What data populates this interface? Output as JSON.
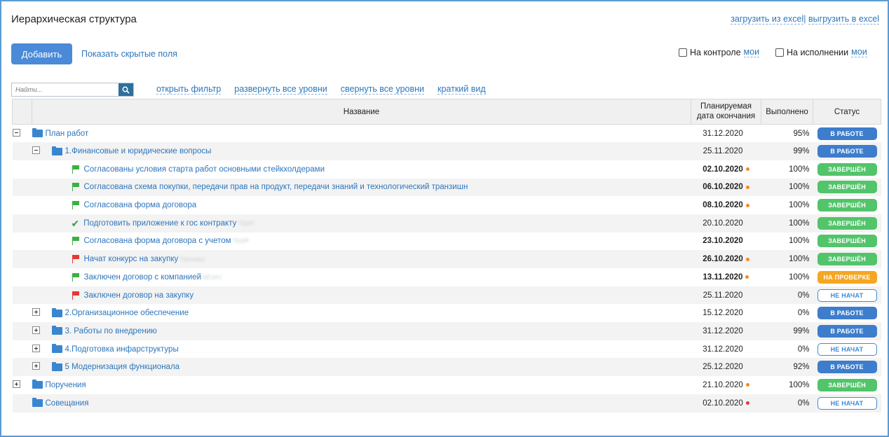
{
  "header": {
    "title": "Иерархическая структура",
    "upload_excel": "загрузить из excel",
    "separator": "|",
    "download_excel": "выгрузить в excel"
  },
  "toolbar": {
    "add_label": "Добавить",
    "show_hidden_label": "Показать скрытые поля",
    "control_label": "На контроле",
    "control_mine": "мои",
    "exec_label": "На исполнении",
    "exec_mine": "мои"
  },
  "search": {
    "placeholder": "Найти..."
  },
  "tools": {
    "open_filter": "открыть фильтр",
    "expand_all": "развернуть все уровни",
    "collapse_all": "свернуть все уровни",
    "brief_view": "краткий вид"
  },
  "table": {
    "col_name": "Название",
    "col_date_1": "Планируемая",
    "col_date_2": "дата окончания",
    "col_done": "Выполнено",
    "col_status": "Статус"
  },
  "colors": {
    "accent": "#4a8ad8",
    "link": "#2d76bb",
    "status_work": "#3d7dcc",
    "status_done": "#52c46a",
    "status_review": "#f5a623",
    "flag_green": "#3cb043",
    "flag_red": "#e53935",
    "dot_orange": "#f5891f",
    "dot_red": "#e53935"
  },
  "rows": [
    {
      "level": 0,
      "toggle": "minus",
      "icon": "folder-icon",
      "name": "План работ",
      "blur": "",
      "date": "31.12.2020",
      "bold": false,
      "dot": "",
      "pct": "95%",
      "status": "В РАБОТЕ",
      "kind": "work",
      "alt": false
    },
    {
      "level": 1,
      "toggle": "minus",
      "icon": "folder-icon",
      "name": "1.Финансовые и юридические вопросы",
      "blur": "",
      "date": "25.11.2020",
      "bold": false,
      "dot": "",
      "pct": "99%",
      "status": "В РАБОТЕ",
      "kind": "work",
      "alt": true
    },
    {
      "level": 2,
      "toggle": "",
      "icon": "green-flag-icon",
      "name": "Согласованы условия старта работ основными стейкхолдерами",
      "blur": "",
      "date": "02.10.2020",
      "bold": true,
      "dot": "orange",
      "pct": "100%",
      "status": "ЗАВЕРШЁН",
      "kind": "done",
      "alt": false
    },
    {
      "level": 2,
      "toggle": "",
      "icon": "green-flag-icon",
      "name": "Согласована схема покупки, передачи прав на продукт, передачи знаний и технологический транзишн",
      "blur": "",
      "date": "06.10.2020",
      "bold": true,
      "dot": "orange",
      "pct": "100%",
      "status": "ЗАВЕРШЁН",
      "kind": "done",
      "alt": true
    },
    {
      "level": 2,
      "toggle": "",
      "icon": "green-flag-icon",
      "name": "Согласована форма договора",
      "blur": "",
      "date": "08.10.2020",
      "bold": true,
      "dot": "orange",
      "pct": "100%",
      "status": "ЗАВЕРШЁН",
      "kind": "done",
      "alt": false
    },
    {
      "level": 2,
      "toggle": "",
      "icon": "check-icon",
      "name": "Подготовить приложение к гос контракту",
      "blur": "ТБИР",
      "date": "20.10.2020",
      "bold": false,
      "dot": "",
      "pct": "100%",
      "status": "ЗАВЕРШЁН",
      "kind": "done",
      "alt": true
    },
    {
      "level": 2,
      "toggle": "",
      "icon": "green-flag-icon",
      "name": "Согласована форма договора с учетом",
      "blur": "ТБИР",
      "date": "23.10.2020",
      "bold": true,
      "dot": "",
      "pct": "100%",
      "status": "ЗАВЕРШЁН",
      "kind": "done",
      "alt": false
    },
    {
      "level": 2,
      "toggle": "",
      "icon": "red-flag-icon",
      "name": "Начат конкурс на закупку",
      "blur": "Тагонаш",
      "date": "26.10.2020",
      "bold": true,
      "dot": "orange",
      "pct": "100%",
      "status": "ЗАВЕРШЁН",
      "kind": "done",
      "alt": true
    },
    {
      "level": 2,
      "toggle": "",
      "icon": "green-flag-icon",
      "name": "Заключен договор с компанией",
      "blur": "МСИН",
      "date": "13.11.2020",
      "bold": true,
      "dot": "orange",
      "pct": "100%",
      "status": "НА ПРОВЕРКЕ",
      "kind": "review",
      "alt": false
    },
    {
      "level": 2,
      "toggle": "",
      "icon": "red-flag-icon",
      "name": "Заключен договор на закупку",
      "blur": "",
      "date": "25.11.2020",
      "bold": false,
      "dot": "",
      "pct": "0%",
      "status": "НЕ НАЧАТ",
      "kind": "new",
      "alt": true
    },
    {
      "level": 1,
      "toggle": "plus",
      "icon": "folder-icon",
      "name": "2.Организационное обеспечение",
      "blur": "",
      "date": "15.12.2020",
      "bold": false,
      "dot": "",
      "pct": "0%",
      "status": "В РАБОТЕ",
      "kind": "work",
      "alt": false
    },
    {
      "level": 1,
      "toggle": "plus",
      "icon": "folder-icon",
      "name": "3. Работы по внедрению",
      "blur": "",
      "date": "31.12.2020",
      "bold": false,
      "dot": "",
      "pct": "99%",
      "status": "В РАБОТЕ",
      "kind": "work",
      "alt": true
    },
    {
      "level": 1,
      "toggle": "plus",
      "icon": "folder-icon",
      "name": "4.Подготовка инфарструктуры",
      "blur": "",
      "date": "31.12.2020",
      "bold": false,
      "dot": "",
      "pct": "0%",
      "status": "НЕ НАЧАТ",
      "kind": "new",
      "alt": false
    },
    {
      "level": 1,
      "toggle": "plus",
      "icon": "folder-icon",
      "name": "5 Модернизация функционала",
      "blur": "",
      "date": "25.12.2020",
      "bold": false,
      "dot": "",
      "pct": "92%",
      "status": "В РАБОТЕ",
      "kind": "work",
      "alt": true
    },
    {
      "level": 0,
      "toggle": "plus",
      "icon": "folder-icon",
      "name": "Поручения",
      "blur": "",
      "date": "21.10.2020",
      "bold": false,
      "dot": "orange",
      "pct": "100%",
      "status": "ЗАВЕРШЁН",
      "kind": "done",
      "alt": false
    },
    {
      "level": 0,
      "toggle": "",
      "icon": "folder-icon",
      "name": "Совещания",
      "blur": "",
      "date": "02.10.2020",
      "bold": false,
      "dot": "red",
      "pct": "0%",
      "status": "НЕ НАЧАТ",
      "kind": "new",
      "alt": true
    }
  ]
}
